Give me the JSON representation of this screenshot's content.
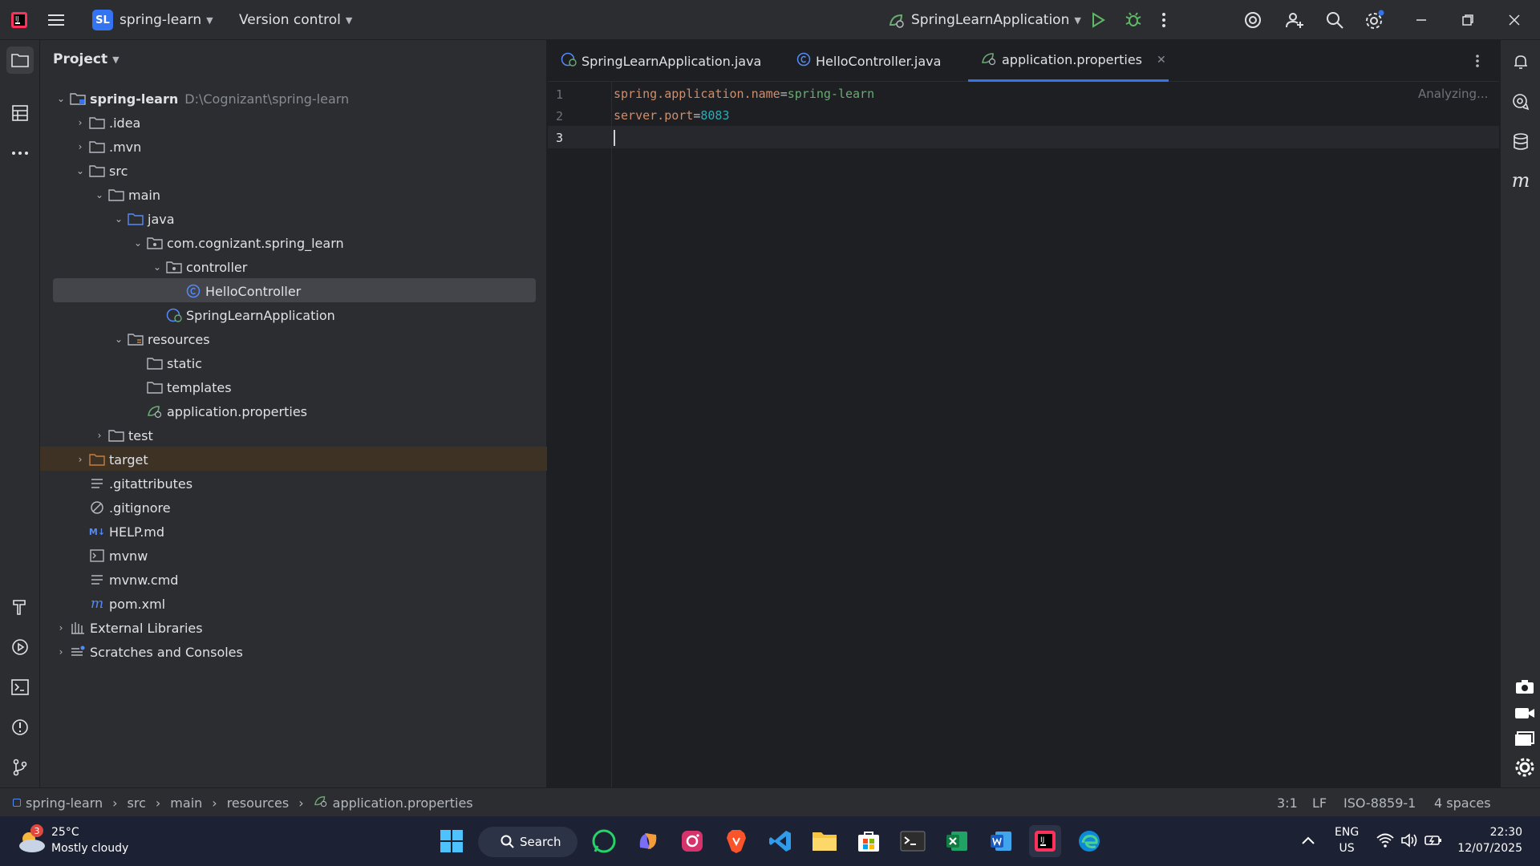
{
  "titlebar": {
    "project_badge": "SL",
    "project_name": "spring-learn",
    "vcs": "Version control",
    "run_config": "SpringLearnApplication"
  },
  "project_panel": {
    "title": "Project",
    "tree": [
      {
        "label": "spring-learn",
        "hint": "D:\\Cognizant\\spring-learn",
        "bold": true
      },
      {
        "label": ".idea"
      },
      {
        "label": ".mvn"
      },
      {
        "label": "src"
      },
      {
        "label": "main"
      },
      {
        "label": "java"
      },
      {
        "label": "com.cognizant.spring_learn"
      },
      {
        "label": "controller"
      },
      {
        "label": "HelloController"
      },
      {
        "label": "SpringLearnApplication"
      },
      {
        "label": "resources"
      },
      {
        "label": "static"
      },
      {
        "label": "templates"
      },
      {
        "label": "application.properties"
      },
      {
        "label": "test"
      },
      {
        "label": "target"
      },
      {
        "label": ".gitattributes"
      },
      {
        "label": ".gitignore"
      },
      {
        "label": "HELP.md"
      },
      {
        "label": "mvnw"
      },
      {
        "label": "mvnw.cmd"
      },
      {
        "label": "pom.xml"
      },
      {
        "label": "External Libraries"
      },
      {
        "label": "Scratches and Consoles"
      }
    ]
  },
  "editor": {
    "tabs": [
      {
        "label": "SpringLearnApplication.java"
      },
      {
        "label": "HelloController.java"
      },
      {
        "label": "application.properties"
      }
    ],
    "status": "Analyzing...",
    "line_numbers": [
      "1",
      "2",
      "3"
    ],
    "lines": [
      {
        "key": "spring.application.name",
        "eq": "=",
        "value": "spring-learn"
      },
      {
        "key": "server.port",
        "eq": "=",
        "value": "8083"
      }
    ]
  },
  "statusbar": {
    "breadcrumb": [
      "spring-learn",
      "src",
      "main",
      "resources",
      "application.properties"
    ],
    "position": "3:1",
    "line_sep": "LF",
    "encoding": "ISO-8859-1",
    "indent": "4 spaces"
  },
  "taskbar": {
    "weather_temp": "25°C",
    "weather_desc": "Mostly cloudy",
    "weather_badge": "3",
    "search_label": "Search",
    "lang_line1": "ENG",
    "lang_line2": "US",
    "time": "22:30",
    "date": "12/07/2025"
  },
  "colors": {
    "accent": "#3574f0",
    "selection": "#43454a",
    "excluded_row": "#3d3223"
  }
}
